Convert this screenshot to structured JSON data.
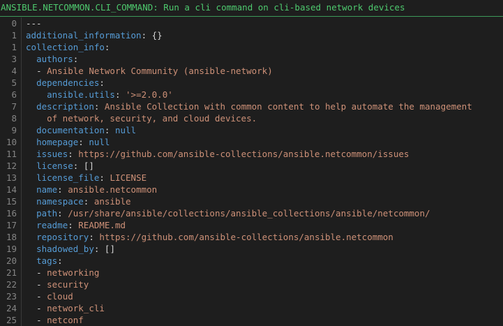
{
  "header": {
    "title": "ANSIBLE.NETCOMMON.CLI_COMMAND: Run a cli command on cli-based network devices"
  },
  "colors": {
    "header_text": "#4ec96e",
    "key": "#569cd6",
    "value": "#ce9178",
    "background": "#1e1e1e"
  },
  "lines": [
    {
      "num": "0",
      "indent": "",
      "key": "",
      "sep": "---",
      "val": "",
      "vclass": "p"
    },
    {
      "num": "1",
      "indent": "",
      "key": "additional_information",
      "sep": ": ",
      "val": "{}",
      "vclass": "p"
    },
    {
      "num": "1",
      "indent": "",
      "key": "collection_info",
      "sep": ":",
      "val": "",
      "vclass": "p"
    },
    {
      "num": "3",
      "indent": "  ",
      "key": "authors",
      "sep": ":",
      "val": "",
      "vclass": "p"
    },
    {
      "num": "4",
      "indent": "  ",
      "key": "",
      "sep": "- ",
      "val": "Ansible Network Community (ansible-network)",
      "vclass": "s"
    },
    {
      "num": "5",
      "indent": "  ",
      "key": "dependencies",
      "sep": ":",
      "val": "",
      "vclass": "p"
    },
    {
      "num": "6",
      "indent": "    ",
      "key": "ansible.utils",
      "sep": ": ",
      "val": "'>=2.0.0'",
      "vclass": "s"
    },
    {
      "num": "7",
      "indent": "  ",
      "key": "description",
      "sep": ": ",
      "val": "Ansible Collection with common content to help automate the management",
      "vclass": "s"
    },
    {
      "num": "8",
      "indent": "    ",
      "key": "",
      "sep": "",
      "val": "of network, security, and cloud devices.",
      "vclass": "s"
    },
    {
      "num": "9",
      "indent": "  ",
      "key": "documentation",
      "sep": ": ",
      "val": "null",
      "vclass": "n"
    },
    {
      "num": "10",
      "indent": "  ",
      "key": "homepage",
      "sep": ": ",
      "val": "null",
      "vclass": "n"
    },
    {
      "num": "11",
      "indent": "  ",
      "key": "issues",
      "sep": ": ",
      "val": "https://github.com/ansible-collections/ansible.netcommon/issues",
      "vclass": "s"
    },
    {
      "num": "12",
      "indent": "  ",
      "key": "license",
      "sep": ": ",
      "val": "[]",
      "vclass": "p"
    },
    {
      "num": "13",
      "indent": "  ",
      "key": "license_file",
      "sep": ": ",
      "val": "LICENSE",
      "vclass": "s"
    },
    {
      "num": "14",
      "indent": "  ",
      "key": "name",
      "sep": ": ",
      "val": "ansible.netcommon",
      "vclass": "s"
    },
    {
      "num": "15",
      "indent": "  ",
      "key": "namespace",
      "sep": ": ",
      "val": "ansible",
      "vclass": "s"
    },
    {
      "num": "16",
      "indent": "  ",
      "key": "path",
      "sep": ": ",
      "val": "/usr/share/ansible/collections/ansible_collections/ansible/netcommon/",
      "vclass": "s"
    },
    {
      "num": "17",
      "indent": "  ",
      "key": "readme",
      "sep": ": ",
      "val": "README.md",
      "vclass": "s"
    },
    {
      "num": "18",
      "indent": "  ",
      "key": "repository",
      "sep": ": ",
      "val": "https://github.com/ansible-collections/ansible.netcommon",
      "vclass": "s"
    },
    {
      "num": "19",
      "indent": "  ",
      "key": "shadowed_by",
      "sep": ": ",
      "val": "[]",
      "vclass": "p"
    },
    {
      "num": "20",
      "indent": "  ",
      "key": "tags",
      "sep": ":",
      "val": "",
      "vclass": "p"
    },
    {
      "num": "21",
      "indent": "  ",
      "key": "",
      "sep": "- ",
      "val": "networking",
      "vclass": "s"
    },
    {
      "num": "22",
      "indent": "  ",
      "key": "",
      "sep": "- ",
      "val": "security",
      "vclass": "s"
    },
    {
      "num": "23",
      "indent": "  ",
      "key": "",
      "sep": "- ",
      "val": "cloud",
      "vclass": "s"
    },
    {
      "num": "24",
      "indent": "  ",
      "key": "",
      "sep": "- ",
      "val": "network_cli",
      "vclass": "s"
    },
    {
      "num": "25",
      "indent": "  ",
      "key": "",
      "sep": "- ",
      "val": "netconf",
      "vclass": "s"
    }
  ]
}
